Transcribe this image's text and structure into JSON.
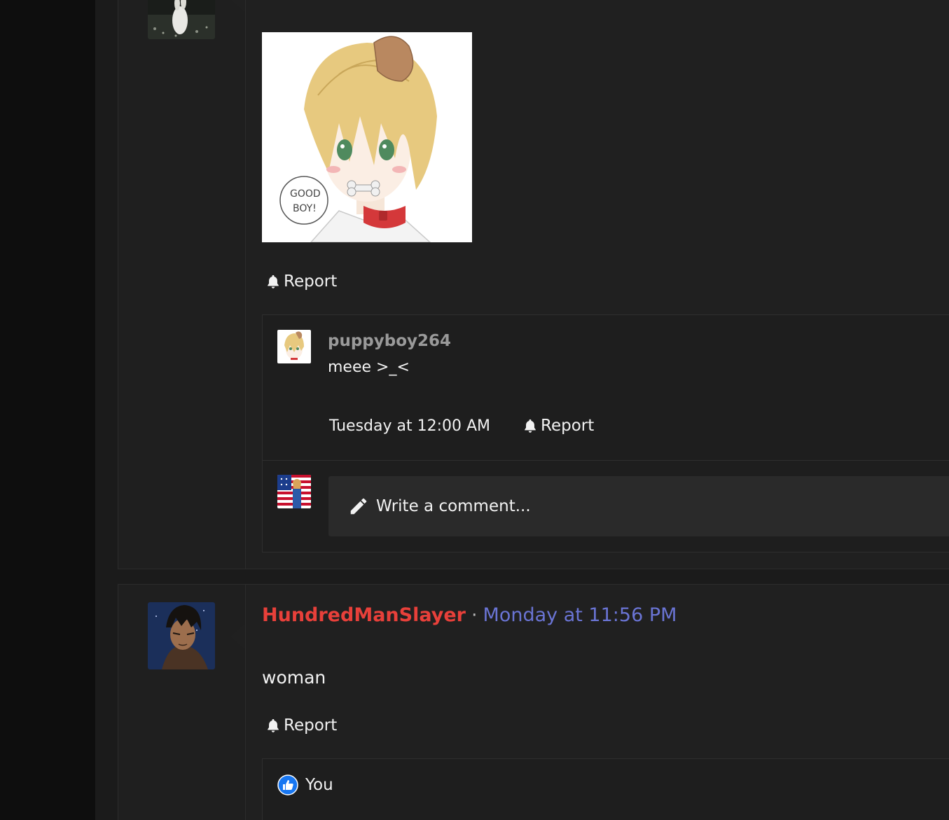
{
  "post1": {
    "report_label": "Report",
    "image_caption": "GOOD BOY!",
    "comments": [
      {
        "author": "puppyboy264",
        "text": "meee >_<",
        "time": "Tuesday at 12:00 AM",
        "report_label": "Report"
      }
    ],
    "write_comment_placeholder": "Write a comment..."
  },
  "post2": {
    "author": "HundredManSlayer",
    "separator": "·",
    "time": "Monday at 11:56 PM",
    "body": "woman",
    "report_label": "Report",
    "reactions": {
      "label": "You",
      "icon": "thumbs-up-icon",
      "color": "#1877f2"
    }
  },
  "colors": {
    "author_red": "#e8403a",
    "link_blue": "#6a74d4",
    "background": "#1b1b1b",
    "panel": "#202020"
  }
}
